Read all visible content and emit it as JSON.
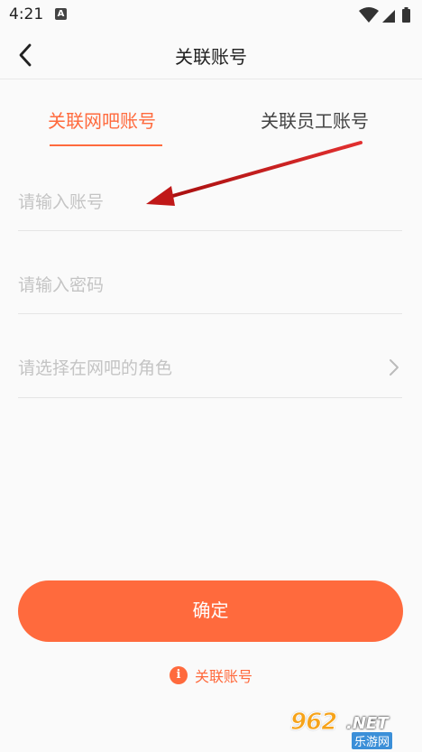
{
  "status_bar": {
    "time": "4:21",
    "notification_icon": "A"
  },
  "header": {
    "title": "关联账号",
    "back_icon": "chevron-left-icon"
  },
  "tabs": [
    {
      "label": "关联网吧账号",
      "active": true
    },
    {
      "label": "关联员工账号",
      "active": false
    }
  ],
  "form": {
    "account_placeholder": "请输入账号",
    "password_placeholder": "请输入密码",
    "role_placeholder": "请选择在网吧的角色"
  },
  "confirm_label": "确定",
  "footer": {
    "link_label": "关联账号",
    "info_icon_glyph": "i"
  },
  "watermark": {
    "big": "962",
    "net": ".NET",
    "sub": "乐游网"
  },
  "colors": {
    "accent": "#ff6a3d",
    "annotation_arrow": "#d41c1c",
    "placeholder": "#c4c4c4"
  }
}
